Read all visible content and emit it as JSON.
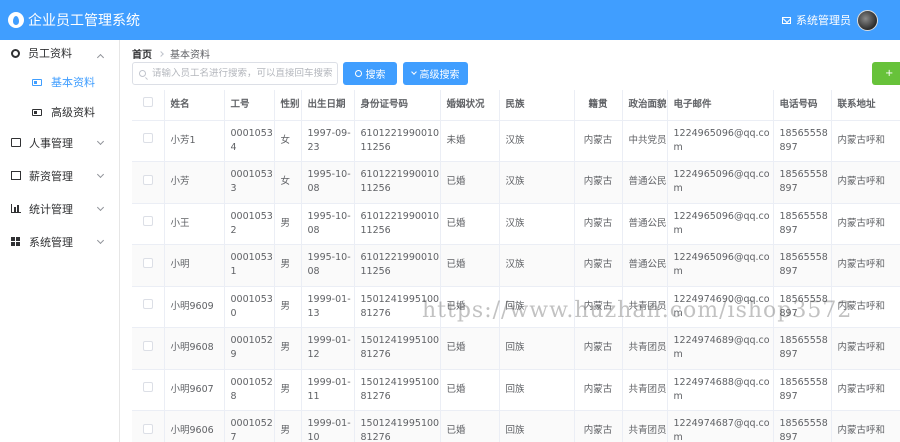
{
  "app": {
    "title": "企业员工管理系统",
    "user": "系统管理员"
  },
  "sidebar": {
    "groups": [
      {
        "label": "员工资料",
        "icon": "user-icon",
        "expanded": true,
        "children": [
          {
            "label": "基本资料",
            "active": true
          },
          {
            "label": "高级资料",
            "active": false
          }
        ]
      },
      {
        "label": "人事管理",
        "icon": "card-icon"
      },
      {
        "label": "薪资管理",
        "icon": "money-icon"
      },
      {
        "label": "统计管理",
        "icon": "chart-icon"
      },
      {
        "label": "系统管理",
        "icon": "windows-icon"
      }
    ]
  },
  "breadcrumb": {
    "home": "首页",
    "current": "基本资料"
  },
  "toolbar": {
    "search_placeholder": "请输入员工名进行搜索，可以直接回车搜索...",
    "search_label": "搜索",
    "advanced_label": "高级搜索",
    "add_label": "+"
  },
  "table": {
    "headers": [
      "姓名",
      "工号",
      "性别",
      "出生日期",
      "身份证号码",
      "婚姻状况",
      "民族",
      "籍贯",
      "政治面貌",
      "电子邮件",
      "电话号码",
      "联系地址"
    ],
    "rows": [
      [
        "小芳1",
        "00010534",
        "女",
        "1997-09-23",
        "610122199001011256",
        "未婚",
        "汉族",
        "内蒙古",
        "中共党员",
        "1224965096@qq.com",
        "18565558897",
        "内蒙古呼和"
      ],
      [
        "小芳",
        "00010533",
        "女",
        "1995-10-08",
        "610122199001011256",
        "已婚",
        "汉族",
        "内蒙古",
        "普通公民",
        "1224965096@qq.com",
        "18565558897",
        "内蒙古呼和"
      ],
      [
        "小王",
        "00010532",
        "男",
        "1995-10-08",
        "610122199001011256",
        "已婚",
        "汉族",
        "内蒙古",
        "普通公民",
        "1224965096@qq.com",
        "18565558897",
        "内蒙古呼和"
      ],
      [
        "小明",
        "00010531",
        "男",
        "1995-10-08",
        "610122199001011256",
        "已婚",
        "汉族",
        "内蒙古",
        "普通公民",
        "1224965096@qq.com",
        "18565558897",
        "内蒙古呼和"
      ],
      [
        "小明9609",
        "00010530",
        "男",
        "1999-01-13",
        "150124199510081276",
        "已婚",
        "回族",
        "内蒙古",
        "共青团员",
        "1224974690@qq.com",
        "18565558897",
        "内蒙古呼和"
      ],
      [
        "小明9608",
        "00010529",
        "男",
        "1999-01-12",
        "150124199510081276",
        "已婚",
        "回族",
        "内蒙古",
        "共青团员",
        "1224974689@qq.com",
        "18565558897",
        "内蒙古呼和"
      ],
      [
        "小明9607",
        "00010528",
        "男",
        "1999-01-11",
        "150124199510081276",
        "已婚",
        "回族",
        "内蒙古",
        "共青团员",
        "1224974688@qq.com",
        "18565558897",
        "内蒙古呼和"
      ],
      [
        "小明9606",
        "00010527",
        "男",
        "1999-01-10",
        "150124199510081276",
        "已婚",
        "回族",
        "内蒙古",
        "共青团员",
        "1224974687@qq.com",
        "18565558897",
        "内蒙古呼和"
      ]
    ]
  },
  "watermark": "https://www.huzhan.com/ishop3572"
}
